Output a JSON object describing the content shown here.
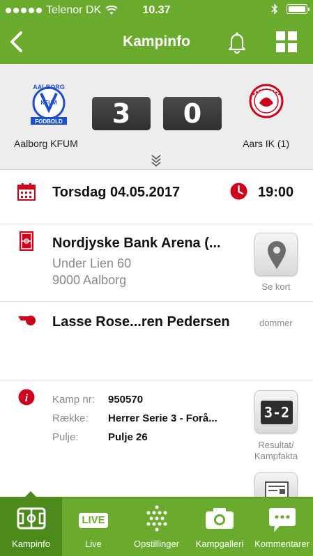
{
  "status_bar": {
    "carrier": "Telenor DK",
    "time": "10.37"
  },
  "nav": {
    "title": "Kampinfo",
    "back_icon": "chevron-left-icon",
    "bell_icon": "bell-icon",
    "menu_icon": "grid-icon"
  },
  "match": {
    "home_team": "Aalborg KFUM",
    "away_team": "Aars IK (1)",
    "home_score": "3",
    "away_score": "0",
    "home_logo_text_top": "AALBORG",
    "home_logo_text_mid": "KFUM",
    "home_logo_text_bottom": "FODBOLD"
  },
  "datetime": {
    "date": "Torsdag 04.05.2017",
    "time": "19:00"
  },
  "venue": {
    "name": "Nordjyske Bank Arena (...",
    "address_line1": "Under Lien 60",
    "address_line2": "9000 Aalborg",
    "map_button_label": "Se kort"
  },
  "referee": {
    "name": "Lasse Rose...ren Pedersen",
    "role": "dommer"
  },
  "details": {
    "rows": [
      {
        "label": "Kamp nr:",
        "value": "950570"
      },
      {
        "label": "Række:",
        "value": "Herrer Serie 3 - Forå..."
      },
      {
        "label": "Pulje:",
        "value": "Pulje 26"
      }
    ],
    "result_button_label_line1": "Resultat/",
    "result_button_label_line2": "Kampfakta",
    "result_tile_text": "3-2"
  },
  "tabs": [
    {
      "label": "Kampinfo",
      "icon": "pitch-icon",
      "active": true
    },
    {
      "label": "Live",
      "icon": "live-icon",
      "active": false
    },
    {
      "label": "Opstillinger",
      "icon": "formation-icon",
      "active": false
    },
    {
      "label": "Kampgalleri",
      "icon": "camera-icon",
      "active": false
    },
    {
      "label": "Kommentarer",
      "icon": "comment-icon",
      "active": false
    }
  ],
  "tab_live_badge": "LIVE",
  "colors": {
    "brand_green": "#6aab2e",
    "active_tab": "#4d8a1c",
    "accent_red": "#d0021b",
    "home_blue": "#1f4fd1"
  }
}
